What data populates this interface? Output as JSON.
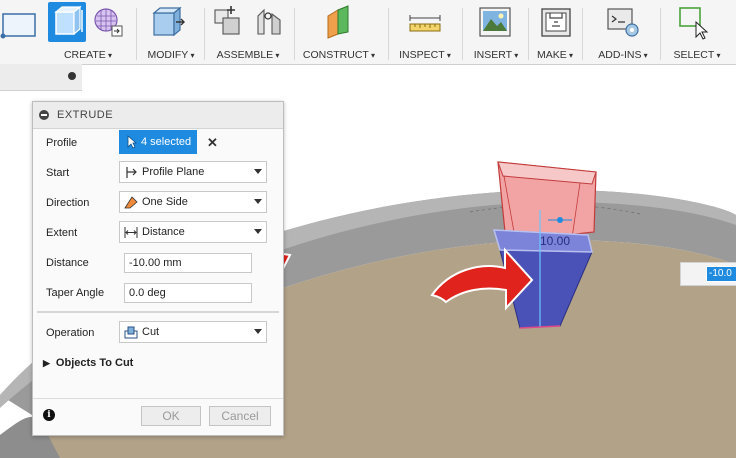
{
  "toolbar": {
    "groups": [
      {
        "label": "CREATE"
      },
      {
        "label": "MODIFY"
      },
      {
        "label": "ASSEMBLE"
      },
      {
        "label": "CONSTRUCT"
      },
      {
        "label": "INSPECT"
      },
      {
        "label": "INSERT"
      },
      {
        "label": "MAKE"
      },
      {
        "label": "ADD-INS"
      },
      {
        "label": "SELECT"
      }
    ]
  },
  "dialog": {
    "title": "EXTRUDE",
    "profile": {
      "label": "Profile",
      "value": "4 selected"
    },
    "start": {
      "label": "Start",
      "value": "Profile Plane"
    },
    "direction": {
      "label": "Direction",
      "value": "One Side"
    },
    "extent": {
      "label": "Extent",
      "value": "Distance"
    },
    "distance": {
      "label": "Distance",
      "value": "-10.00 mm"
    },
    "taper": {
      "label": "Taper Angle",
      "value": "0.0 deg"
    },
    "operation": {
      "label": "Operation",
      "value": "Cut"
    },
    "objects_to_cut": "Objects To Cut",
    "ok_label": "OK",
    "cancel_label": "Cancel"
  },
  "viewport": {
    "dimension_label": "10.00",
    "value_input": "-10.0"
  },
  "colors": {
    "accent": "#1f8be0",
    "annotation_arrow": "#e0231c",
    "surface": "#b2a288",
    "cut_body": "#4a52b8",
    "extrude_body": "#f08a8a"
  }
}
